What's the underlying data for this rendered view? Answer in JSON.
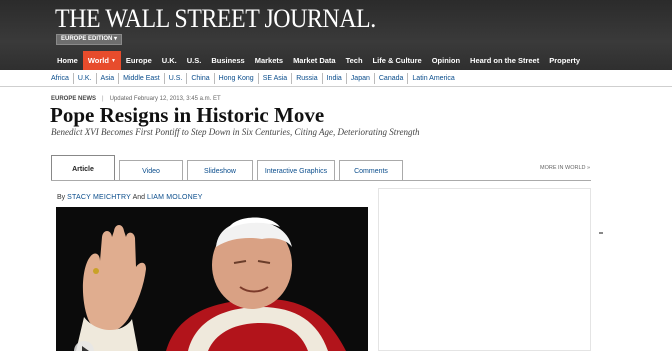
{
  "header": {
    "logo": "THE WALL STREET JOURNAL.",
    "edition_label": "EUROPE EDITION ▾"
  },
  "main_nav": [
    {
      "label": "Home",
      "active": false
    },
    {
      "label": "World",
      "active": true
    },
    {
      "label": "Europe",
      "active": false
    },
    {
      "label": "U.K.",
      "active": false
    },
    {
      "label": "U.S.",
      "active": false
    },
    {
      "label": "Business",
      "active": false
    },
    {
      "label": "Markets",
      "active": false
    },
    {
      "label": "Market Data",
      "active": false
    },
    {
      "label": "Tech",
      "active": false
    },
    {
      "label": "Life & Culture",
      "active": false
    },
    {
      "label": "Opinion",
      "active": false
    },
    {
      "label": "Heard on the Street",
      "active": false
    },
    {
      "label": "Property",
      "active": false
    }
  ],
  "sub_nav": [
    "Africa",
    "U.K.",
    "Asia",
    "Middle East",
    "U.S.",
    "China",
    "Hong Kong",
    "SE Asia",
    "Russia",
    "India",
    "Japan",
    "Canada",
    "Latin America"
  ],
  "article": {
    "section": "EUROPE NEWS",
    "separator": "|",
    "updated": "Updated February 12, 2013, 3:45 a.m. ET",
    "headline": "Pope Resigns in Historic Move",
    "dek": "Benedict XVI Becomes First Pontiff to Step Down in Six Centuries, Citing Age, Deteriorating Strength",
    "byline_prefix": "By",
    "author1": "Stacy Meichtry",
    "byline_and": "And",
    "author2": "Liam Moloney"
  },
  "tabs": [
    {
      "label": "Article",
      "active": true
    },
    {
      "label": "Video",
      "active": false
    },
    {
      "label": "Slideshow",
      "active": false
    },
    {
      "label": "Interactive Graphics",
      "active": false
    },
    {
      "label": "Comments",
      "active": false
    }
  ],
  "more_link": "MORE IN WORLD »",
  "colors": {
    "nav_active": "#e74c2c",
    "link": "#0a4d8c",
    "masthead": "#2f2f2f"
  },
  "icons": {
    "play": "play-icon",
    "dropdown": "chevron-down-icon"
  }
}
